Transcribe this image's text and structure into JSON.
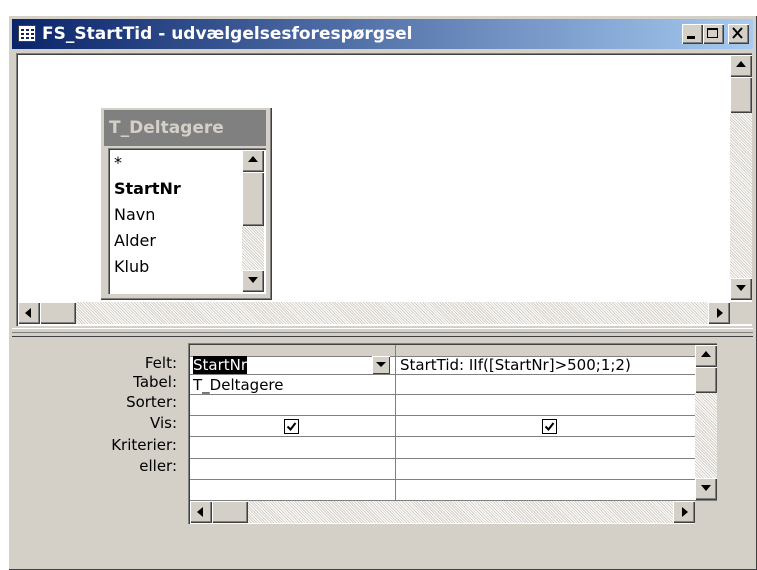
{
  "window": {
    "title": "FS_StartTid - udvælgelsesforespørgsel"
  },
  "table": {
    "title": "T_Deltagere",
    "fields": [
      "*",
      "StartNr",
      "Navn",
      "Alder",
      "Klub"
    ],
    "primary_key": "StartNr"
  },
  "design_grid": {
    "row_labels": [
      "Felt:",
      "Tabel:",
      "Sorter:",
      "Vis:",
      "Kriterier:",
      "eller:"
    ],
    "columns": [
      {
        "felt": "StartNr",
        "tabel": "T_Deltagere",
        "sorter": "",
        "vis": true,
        "kriterier": "",
        "eller": ""
      },
      {
        "felt": "StartTid: IIf([StartNr]>500;1;2)",
        "tabel": "",
        "sorter": "",
        "vis": true,
        "kriterier": "",
        "eller": ""
      }
    ]
  },
  "icons": {
    "window": "query-window-icon",
    "minimize": "minimize-icon",
    "maximize": "maximize-icon",
    "close": "close-icon"
  },
  "colors": {
    "titlebar_start": "#0a246a",
    "titlebar_end": "#a6caf0",
    "face": "#d4d0c8",
    "inactive_table_title": "#808080",
    "selection": "#000000"
  }
}
